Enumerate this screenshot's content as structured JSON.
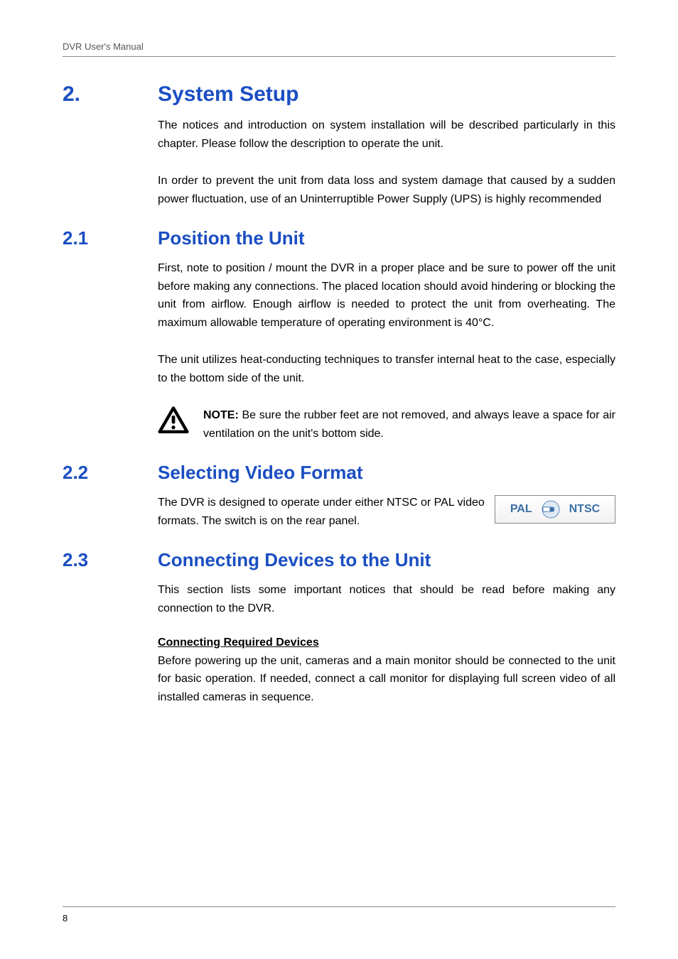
{
  "header": {
    "running_head": "DVR User's Manual"
  },
  "section2": {
    "num": "2.",
    "title": "System Setup",
    "para1": "The notices and introduction on system installation will be described particularly in this chapter. Please follow the description to operate the unit.",
    "para2": "In order to prevent the unit from data loss and system damage that caused by a sudden power fluctuation, use of an Uninterruptible Power Supply (UPS) is highly recommended"
  },
  "section21": {
    "num": "2.1",
    "title": "Position the Unit",
    "para1": "First, note to position / mount the DVR in a proper place and be sure to power off the unit before making any connections. The placed location should avoid hindering or blocking the unit from airflow. Enough airflow is needed to protect the unit from overheating. The maximum allowable temperature of operating environment is 40°C.",
    "para2": "The unit utilizes heat-conducting techniques to transfer internal heat to the case, especially to the bottom side of the unit.",
    "note_label": "NOTE:",
    "note_text": " Be sure the rubber feet are not removed, and always leave a space for air ventilation on the unit's bottom side."
  },
  "section22": {
    "num": "2.2",
    "title": "Selecting Video Format",
    "para1": "The DVR is designed to operate under either NTSC or PAL video formats. The switch is on the rear panel.",
    "pal": "PAL",
    "ntsc": "NTSC"
  },
  "section23": {
    "num": "2.3",
    "title": "Connecting Devices to the Unit",
    "para1": "This section lists some important notices that should be read before making any connection to the DVR.",
    "subhead": "Connecting Required Devices",
    "para2": "Before powering up the unit, cameras and a main monitor should be connected to the unit for basic operation. If needed, connect a call monitor for displaying full screen video of all installed cameras in sequence."
  },
  "footer": {
    "page": "8"
  }
}
